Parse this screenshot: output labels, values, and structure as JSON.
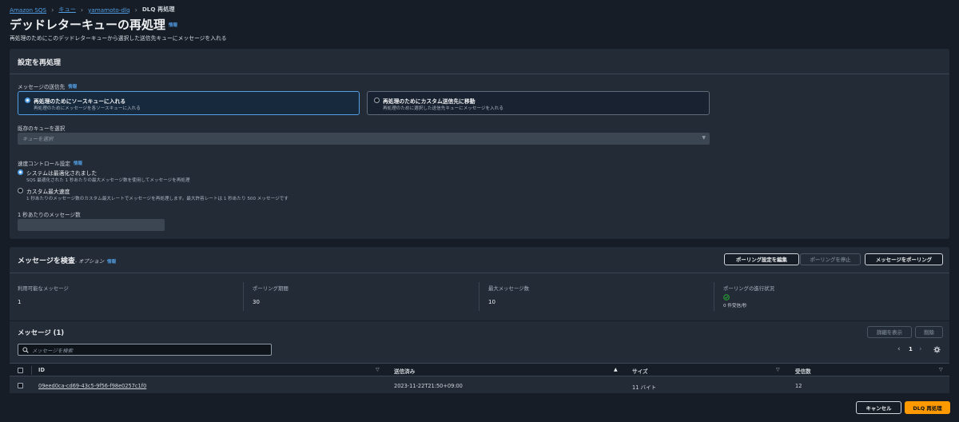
{
  "breadcrumb": {
    "items": [
      "Amazon SQS",
      "キュー",
      "yamamoto-dlq"
    ],
    "current": "DLQ 再処理"
  },
  "page": {
    "title": "デッドレターキューの再処理",
    "info": "情報",
    "description": "再処理のためにこのデッドレターキューから選択した送信先キューにメッセージを入れる"
  },
  "settings": {
    "title": "設定を再処理",
    "destination_label": "メッセージの送信先",
    "destination_info": "情報",
    "option_source": {
      "title": "再処理のためにソースキューに入れる",
      "desc": "再処理のためにメッセージを各ソースキューに入れる",
      "selected": true
    },
    "option_custom": {
      "title": "再処理のためにカスタム送信先に移動",
      "desc": "再処理のために選択した送信先キューにメッセージを入れる",
      "selected": false
    },
    "queue_label": "既存のキューを選択",
    "queue_placeholder": "キューを選択",
    "velocity_label": "速度コントロール設定",
    "velocity_info": "情報",
    "velocity_system": {
      "title": "システムは最適化されました",
      "desc": "SQS 最適化された 1 秒あたりの最大メッセージ数を使用してメッセージを再処理",
      "selected": true
    },
    "velocity_custom": {
      "title": "カスタム最大速度",
      "desc": "1 秒あたりのメッセージ数のカスタム最大レートでメッセージを再処理します。最大許容レートは 1 秒あたり 500 メッセージです",
      "selected": false
    },
    "rate_label": "1 秒あたりのメッセージ数"
  },
  "inspect": {
    "title": "メッセージを検査",
    "optional": " - オプション",
    "info": "情報",
    "edit_polling": "ポーリング設定を編集",
    "stop_polling": "ポーリングを停止",
    "poll_messages": "メッセージをポーリング",
    "stats": [
      {
        "label": "利用可能なメッセージ",
        "value": "1"
      },
      {
        "label": "ポーリング期間",
        "value": "30"
      },
      {
        "label": "最大メッセージ数",
        "value": "10"
      },
      {
        "label": "ポーリングの進行状況",
        "value": "0 件受信/秒"
      }
    ],
    "messages_title": "メッセージ (1)",
    "view_details": "詳細を表示",
    "delete": "削除",
    "search_placeholder": "メッセージを検索",
    "page": "1",
    "columns": [
      "ID",
      "送信済み",
      "サイズ",
      "受信数"
    ],
    "rows": [
      {
        "id": "09eed0ca-cd69-43c5-9f56-f98e0257c1f0",
        "sent": "2023-11-22T21:50+09:00",
        "size": "11 バイト",
        "count": "12"
      }
    ]
  },
  "footer": {
    "cancel": "キャンセル",
    "submit": "DLQ 再処理"
  }
}
